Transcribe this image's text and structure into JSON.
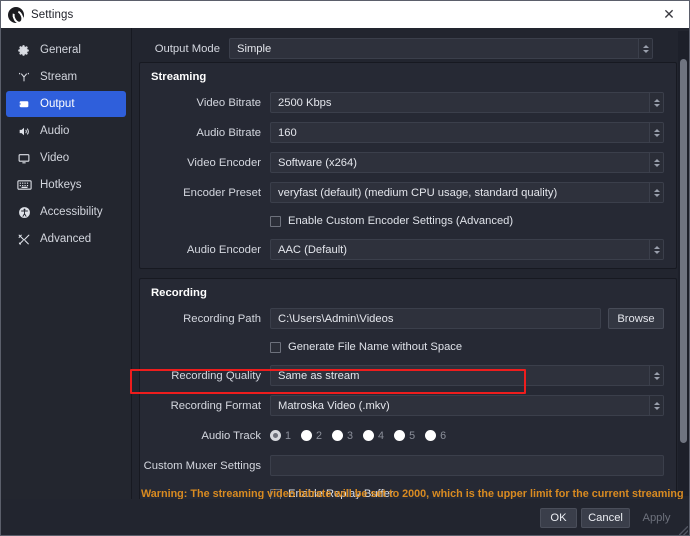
{
  "window": {
    "title": "Settings",
    "app_icon": "obs-logo-icon",
    "close_label": "✕"
  },
  "sidebar": {
    "items": [
      {
        "label": "General",
        "icon": "gear-icon",
        "active": false
      },
      {
        "label": "Stream",
        "icon": "broadcast-icon",
        "active": false
      },
      {
        "label": "Output",
        "icon": "output-screen-icon",
        "active": true
      },
      {
        "label": "Audio",
        "icon": "speaker-icon",
        "active": false
      },
      {
        "label": "Video",
        "icon": "monitor-icon",
        "active": false
      },
      {
        "label": "Hotkeys",
        "icon": "keyboard-icon",
        "active": false
      },
      {
        "label": "Accessibility",
        "icon": "accessibility-icon",
        "active": false
      },
      {
        "label": "Advanced",
        "icon": "tools-icon",
        "active": false
      }
    ]
  },
  "main": {
    "output_mode": {
      "label": "Output Mode",
      "value": "Simple"
    },
    "streaming": {
      "title": "Streaming",
      "video_bitrate": {
        "label": "Video Bitrate",
        "value": "2500 Kbps"
      },
      "audio_bitrate": {
        "label": "Audio Bitrate",
        "value": "160"
      },
      "video_encoder": {
        "label": "Video Encoder",
        "value": "Software (x264)"
      },
      "encoder_preset": {
        "label": "Encoder Preset",
        "value": "veryfast (default) (medium CPU usage, standard quality)"
      },
      "custom_encoder": {
        "label": "Enable Custom Encoder Settings (Advanced)",
        "checked": false
      },
      "audio_encoder": {
        "label": "Audio Encoder",
        "value": "AAC (Default)"
      }
    },
    "recording": {
      "title": "Recording",
      "recording_path": {
        "label": "Recording Path",
        "value": "C:\\Users\\Admin\\Videos",
        "browse_label": "Browse"
      },
      "generate_no_space": {
        "label": "Generate File Name without Space",
        "checked": false
      },
      "recording_quality": {
        "label": "Recording Quality",
        "value": "Same as stream"
      },
      "recording_format": {
        "label": "Recording Format",
        "value": "Matroska Video (.mkv)",
        "highlighted": true
      },
      "audio_track": {
        "label": "Audio Track",
        "tracks": [
          "1",
          "2",
          "3",
          "4",
          "5",
          "6"
        ],
        "selected": "1"
      },
      "custom_muxer": {
        "label": "Custom Muxer Settings",
        "value": "",
        "placeholder": ""
      },
      "replay_buffer": {
        "label": "Enable Replay Buffer",
        "checked": false
      }
    }
  },
  "warning": {
    "text": "Warning: The streaming video bitrate will be set to 2000, which is the upper limit for the current streaming"
  },
  "footer": {
    "ok_label": "OK",
    "cancel_label": "Cancel",
    "apply_label": "Apply"
  },
  "colors": {
    "accent": "#2f5fdb",
    "highlight": "#ee1d1d",
    "warning": "#d98b21",
    "window_bg": "#22252f",
    "group_bg": "#262934"
  }
}
